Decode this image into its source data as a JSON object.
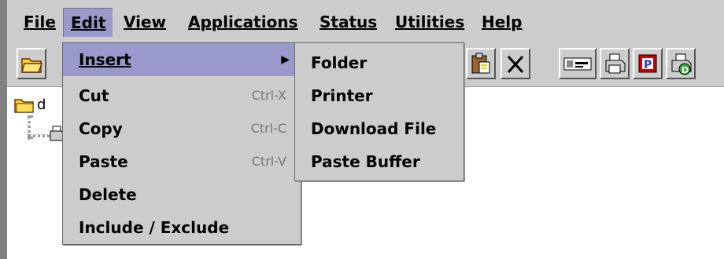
{
  "menubar": {
    "items": [
      "File",
      "Edit",
      "View",
      "Applications",
      "Status",
      "Utilities",
      "Help"
    ],
    "active": "Edit"
  },
  "edit_menu": {
    "items": [
      {
        "label": "Insert",
        "shortcut": "",
        "submenu": true
      },
      {
        "label": "Cut",
        "shortcut": "Ctrl-X"
      },
      {
        "label": "Copy",
        "shortcut": "Ctrl-C"
      },
      {
        "label": "Paste",
        "shortcut": "Ctrl-V"
      },
      {
        "label": "Delete",
        "shortcut": ""
      },
      {
        "label": "Include / Exclude",
        "shortcut": ""
      }
    ]
  },
  "insert_submenu": {
    "items": [
      "Folder",
      "Printer",
      "Download File",
      "Paste Buffer"
    ]
  },
  "tree": {
    "root_label": "d"
  },
  "colors": {
    "chrome": "#cccccc",
    "highlight": "#9999cc",
    "shortcut_text": "#777777"
  }
}
